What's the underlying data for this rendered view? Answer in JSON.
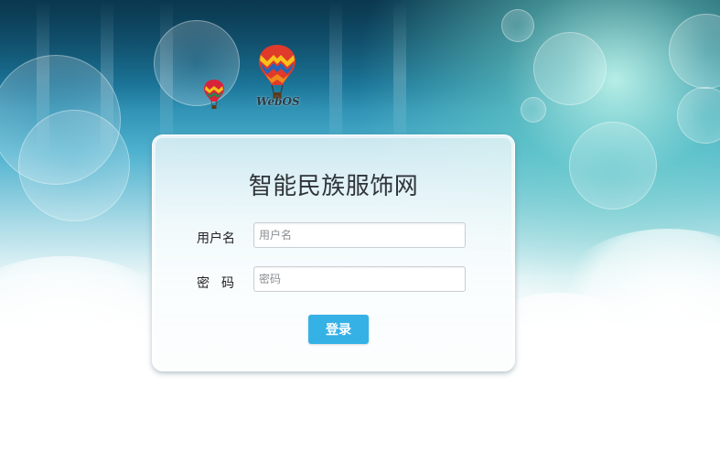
{
  "branding": {
    "logo_text": "WebOS",
    "logo_icon": "hot-air-balloon-icon"
  },
  "login": {
    "title": "智能民族服饰网",
    "username_label": "用户名",
    "username_placeholder": "用户名",
    "username_value": "",
    "password_label": "密码",
    "password_placeholder": "密码",
    "password_value": "",
    "submit_label": "登录"
  },
  "colors": {
    "accent": "#35b1e6",
    "title_text": "#2f3438",
    "sky_dark": "#0f4a66",
    "sky_mid": "#4fb2cf"
  }
}
